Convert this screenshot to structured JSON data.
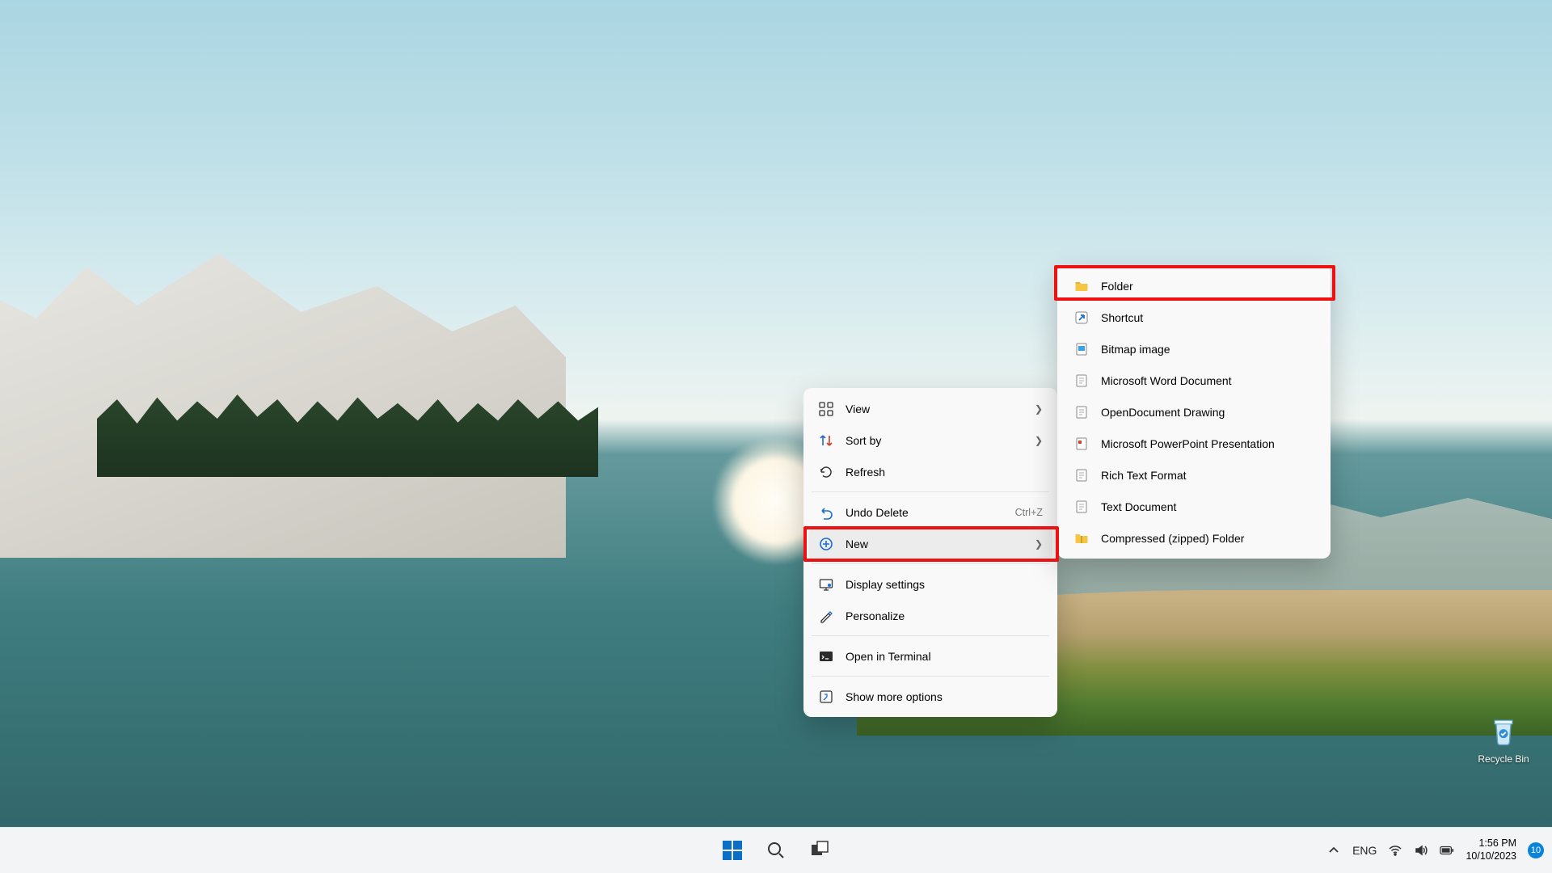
{
  "desktop": {
    "recycle_bin_label": "Recycle Bin"
  },
  "context_menu": {
    "items": [
      {
        "icon": "view",
        "label": "View",
        "chevron": true
      },
      {
        "icon": "sort",
        "label": "Sort by",
        "chevron": true
      },
      {
        "icon": "refresh",
        "label": "Refresh"
      },
      {
        "sep": true
      },
      {
        "icon": "undo",
        "label": "Undo Delete",
        "shortcut": "Ctrl+Z"
      },
      {
        "icon": "new",
        "label": "New",
        "chevron": true,
        "hovered": true,
        "highlighted": true
      },
      {
        "sep": true
      },
      {
        "icon": "display",
        "label": "Display settings"
      },
      {
        "icon": "personalize",
        "label": "Personalize"
      },
      {
        "sep": true
      },
      {
        "icon": "terminal",
        "label": "Open in Terminal"
      },
      {
        "sep": true
      },
      {
        "icon": "more",
        "label": "Show more options"
      }
    ]
  },
  "new_submenu": {
    "items": [
      {
        "icon": "folder",
        "label": "Folder",
        "highlighted": true
      },
      {
        "icon": "shortcut",
        "label": "Shortcut"
      },
      {
        "icon": "bitmap",
        "label": "Bitmap image"
      },
      {
        "icon": "word",
        "label": "Microsoft Word Document"
      },
      {
        "icon": "odg",
        "label": "OpenDocument Drawing"
      },
      {
        "icon": "ppt",
        "label": "Microsoft PowerPoint Presentation"
      },
      {
        "icon": "rtf",
        "label": "Rich Text Format"
      },
      {
        "icon": "txt",
        "label": "Text Document"
      },
      {
        "icon": "zip",
        "label": "Compressed (zipped) Folder"
      }
    ]
  },
  "taskbar": {
    "language": "ENG",
    "time": "1:56 PM",
    "date": "10/10/2023",
    "notification_count": "10"
  }
}
